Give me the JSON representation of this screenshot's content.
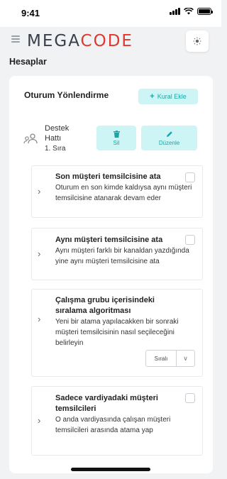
{
  "status_bar": {
    "time": "9:41"
  },
  "header": {
    "logo_left": "MEGA",
    "logo_right": "CODE"
  },
  "page": {
    "title": "Hesaplar"
  },
  "card": {
    "title": "Oturum Yönlendirme",
    "add_rule_label": "Kural Ekle",
    "team": {
      "name": "Destek Hattı",
      "order": "1. Sıra"
    },
    "delete_label": "Sil",
    "edit_label": "Düzenle"
  },
  "rules": [
    {
      "title": "Son müşteri temsilcisine ata",
      "desc": "Oturum en son kimde kaldıysa aynı müşteri temsilcisine atanarak devam eder"
    },
    {
      "title": "Aynı müşteri temsilcisine ata",
      "desc": "Aynı müşteri farklı bir kanaldan yazdığında yine aynı müşteri temsilcisine ata"
    },
    {
      "title": "Çalışma grubu içerisindeki sıralama algoritması",
      "desc": "Yeni bir atama yapılacakken bir sonraki müşteri temsilcisinin nasıl seçileceğini belirleyin",
      "select_value": "Sıralı"
    },
    {
      "title": "Sadece vardiyadaki müşteri temsilcileri",
      "desc": "O anda vardiyasında çalışan müşteri temsilcileri arasında atama yap"
    }
  ],
  "colors": {
    "accent": "#19a7a5",
    "accent_bg": "#cdf5f5",
    "logo_red": "#e2372e"
  },
  "icons": [
    "menu-icon",
    "sun-icon",
    "plus-icon",
    "team-icon",
    "trash-icon",
    "pencil-icon",
    "chevron-right-icon",
    "chevron-down-icon"
  ]
}
